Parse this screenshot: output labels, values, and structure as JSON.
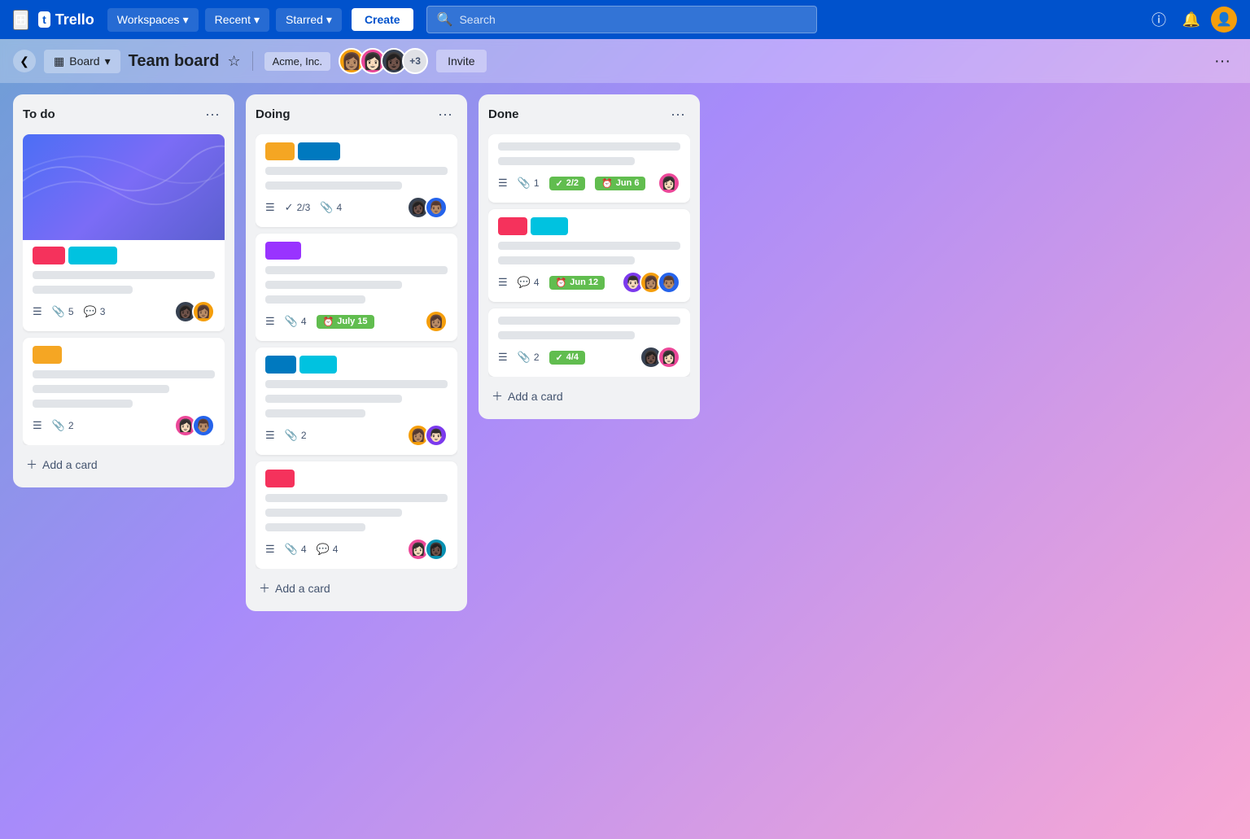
{
  "nav": {
    "logo_text": "Trello",
    "workspaces_label": "Workspaces",
    "recent_label": "Recent",
    "starred_label": "Starred",
    "create_label": "Create",
    "search_placeholder": "Search"
  },
  "board_header": {
    "view_label": "Board",
    "title": "Team board",
    "workspace_label": "Acme, Inc.",
    "more_members_label": "+3",
    "invite_label": "Invite"
  },
  "lists": [
    {
      "title": "To do",
      "cards": [
        {
          "has_cover": true,
          "labels": [
            "pink",
            "cyan"
          ],
          "lines": [
            "medium",
            "short"
          ],
          "attachments": 5,
          "comments": 3,
          "avatars": [
            "dark",
            "yellow"
          ]
        },
        {
          "labels": [
            "yellow"
          ],
          "lines": [
            "full",
            "medium",
            "short"
          ],
          "attachments": 2,
          "avatars": [
            "pink",
            "blue"
          ]
        }
      ],
      "add_label": "Add a card"
    },
    {
      "title": "Doing",
      "cards": [
        {
          "labels": [
            "yellow",
            "blue"
          ],
          "lines": [
            "full",
            "medium"
          ],
          "checklist": "2/3",
          "attachments": 4,
          "avatars": [
            "dark",
            "blue"
          ]
        },
        {
          "labels": [
            "purple"
          ],
          "lines": [
            "full",
            "medium",
            "short"
          ],
          "attachments": 4,
          "due_date": "July 15",
          "avatars": [
            "yellow"
          ]
        },
        {
          "labels": [
            "blue",
            "cyan"
          ],
          "lines": [
            "full",
            "medium",
            "short"
          ],
          "attachments": 2,
          "avatars": [
            "yellow",
            "purple"
          ]
        },
        {
          "labels": [
            "pink"
          ],
          "lines": [
            "full",
            "medium",
            "short"
          ],
          "attachments": 4,
          "comments": 4,
          "avatars": [
            "pink",
            "teal"
          ]
        }
      ],
      "add_label": "Add a card"
    },
    {
      "title": "Done",
      "cards": [
        {
          "lines": [
            "full",
            "medium"
          ],
          "attachments": 1,
          "checklist": "2/2",
          "due_date": "Jun 6",
          "avatars": [
            "pink"
          ]
        },
        {
          "labels": [
            "pink",
            "cyan"
          ],
          "lines": [
            "full",
            "medium"
          ],
          "comments": 4,
          "due_date": "Jun 12",
          "avatars": [
            "purple",
            "yellow",
            "blue"
          ]
        },
        {
          "lines": [
            "full",
            "medium"
          ],
          "attachments": 2,
          "checklist": "4/4",
          "avatars": [
            "dark",
            "pink"
          ]
        }
      ],
      "add_label": "Add a card"
    }
  ]
}
